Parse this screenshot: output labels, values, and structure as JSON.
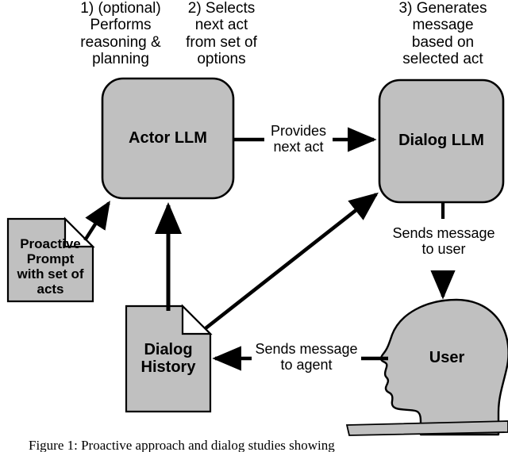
{
  "figure": {
    "caption": "Figure 1:  Proactive approach and dialog studies showing",
    "fill_color": "#C0C0C0",
    "stroke_color": "#000000",
    "background_color": "#FFFFFF"
  },
  "annotations": [
    {
      "id": "step1",
      "text": "1) (optional)\nPerforms\nreasoning &\nplanning"
    },
    {
      "id": "step2",
      "text": "2) Selects\nnext act\nfrom set of\noptions"
    },
    {
      "id": "step3",
      "text": "3) Generates\nmessage\nbased on\nselected act"
    }
  ],
  "nodes": [
    {
      "id": "actor-llm",
      "label": "Actor LLM",
      "shape": "rounded-rectangle"
    },
    {
      "id": "dialog-llm",
      "label": "Dialog LLM",
      "shape": "rounded-rectangle"
    },
    {
      "id": "proactive-prompt",
      "label": "Proactive\nPrompt\nwith set of\nacts",
      "shape": "document"
    },
    {
      "id": "dialog-history",
      "label": "Dialog\nHistory",
      "shape": "document"
    },
    {
      "id": "user",
      "label": "User",
      "shape": "head-silhouette"
    }
  ],
  "edges": [
    {
      "id": "prompt-to-actor",
      "from": "proactive-prompt",
      "to": "actor-llm",
      "label": ""
    },
    {
      "id": "history-to-actor",
      "from": "dialog-history",
      "to": "actor-llm",
      "label": ""
    },
    {
      "id": "actor-to-dialog",
      "from": "actor-llm",
      "to": "dialog-llm",
      "label": "Provides\nnext act"
    },
    {
      "id": "history-to-dialog",
      "from": "dialog-history",
      "to": "dialog-llm",
      "label": ""
    },
    {
      "id": "dialog-to-user",
      "from": "dialog-llm",
      "to": "user",
      "label": "Sends message\nto user"
    },
    {
      "id": "user-to-history",
      "from": "user",
      "to": "dialog-history",
      "label": "Sends message\nto agent"
    }
  ]
}
